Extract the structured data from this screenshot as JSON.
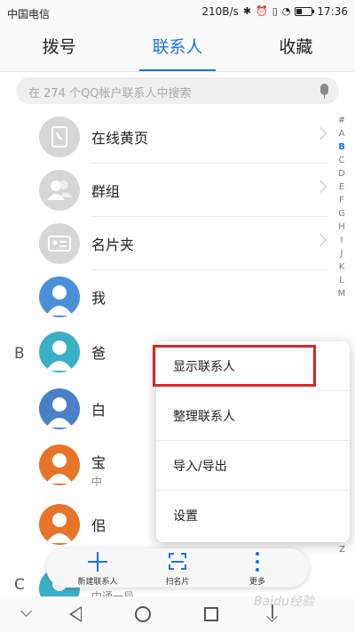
{
  "status_bar": {
    "carrier": "中国电信",
    "net_speed": "210B/s",
    "time": "17:36",
    "icons": [
      "bluetooth-icon",
      "alarm-icon",
      "vibrate-icon",
      "wifi-icon",
      "battery-icon"
    ]
  },
  "tabs": [
    {
      "label": "拨号",
      "active": false
    },
    {
      "label": "联系人",
      "active": true
    },
    {
      "label": "收藏",
      "active": false
    }
  ],
  "search": {
    "placeholder": "在 274 个QQ帐户联系人中搜索"
  },
  "groups": [
    {
      "label": "在线黄页",
      "icon": "phone-book-icon"
    },
    {
      "label": "群组",
      "icon": "group-icon"
    },
    {
      "label": "名片夹",
      "icon": "business-card-icon"
    }
  ],
  "contacts": [
    {
      "label": "我",
      "section": "",
      "avatar_color": "#4a90d9",
      "sub": ""
    },
    {
      "label": "爸",
      "section": "B",
      "avatar_color": "#3ab0c8",
      "sub": ""
    },
    {
      "label": "白",
      "section": "",
      "avatar_color": "#4a80c8",
      "sub": ""
    },
    {
      "label": "宝",
      "section": "",
      "avatar_color": "#e8742a",
      "sub": "中"
    },
    {
      "label": "佀",
      "section": "",
      "avatar_color": "#e8742a",
      "sub": ""
    },
    {
      "label": "",
      "section": "C",
      "avatar_color": "#3ab0c8",
      "sub": "中通一局"
    }
  ],
  "index_bar": {
    "letters": [
      "#",
      "A",
      "B",
      "C",
      "D",
      "E",
      "F",
      "G",
      "H",
      "I",
      "J",
      "K",
      "L",
      "M"
    ],
    "active": "B",
    "last": "Z"
  },
  "more_menu": {
    "items": [
      "显示联系人",
      "整理联系人",
      "导入/导出",
      "设置"
    ],
    "highlighted": "显示联系人"
  },
  "action_bar": {
    "new_contact": "新建联系人",
    "scan_card": "扫名片",
    "more": "更多"
  },
  "colors": {
    "accent": "#1a73e8",
    "highlight": "#d7262b"
  },
  "watermark": "Baidu经验"
}
